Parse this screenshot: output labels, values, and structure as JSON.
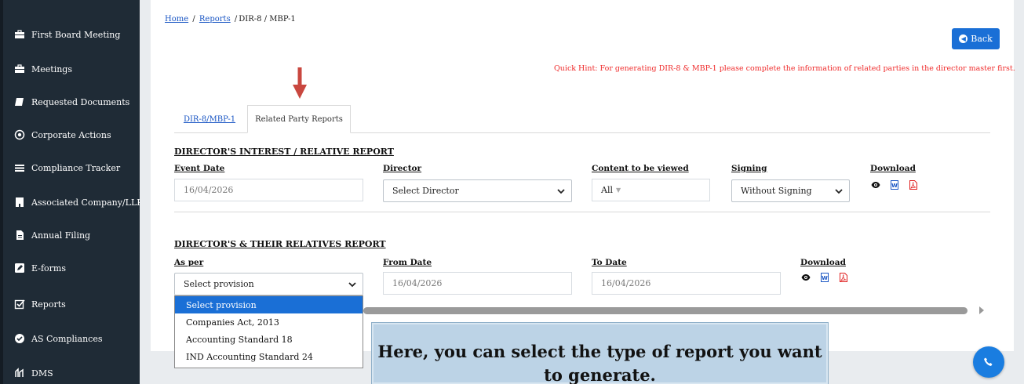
{
  "sidebar": {
    "items": [
      {
        "label": "First Board Meeting",
        "icon": "briefcase-icon"
      },
      {
        "label": "Meetings",
        "icon": "briefcase-icon"
      },
      {
        "label": "Requested Documents",
        "icon": "book-icon"
      },
      {
        "label": "Corporate Actions",
        "icon": "target-icon"
      },
      {
        "label": "Compliance Tracker",
        "icon": "list-icon"
      },
      {
        "label": "Associated Company/LLP",
        "icon": "building-icon"
      },
      {
        "label": "Annual Filing",
        "icon": "file-icon"
      },
      {
        "label": "E-forms",
        "icon": "edit-icon"
      },
      {
        "label": "Reports",
        "icon": "checkbox-icon"
      },
      {
        "label": "AS Compliances",
        "icon": "check-circle-icon"
      },
      {
        "label": "DMS",
        "icon": "dms-icon"
      }
    ]
  },
  "breadcrumb": {
    "home": "Home",
    "sep1": "/",
    "reports": "Reports",
    "sep2": "/",
    "current": "DIR-8 / MBP-1"
  },
  "header": {
    "back_label": "Back",
    "hint": "Quick Hint: For generating DIR-8 & MBP-1 please complete the information of related parties in the director master first."
  },
  "tabs": [
    {
      "label": "DIR-8/MBP-1",
      "active": false
    },
    {
      "label": "Related Party Reports",
      "active": true
    }
  ],
  "section1": {
    "title": "DIRECTOR'S INTEREST / RELATIVE REPORT",
    "event_date_label": "Event Date",
    "event_date_value": "16/04/2026",
    "director_label": "Director",
    "director_value": "Select Director",
    "content_label": "Content to be viewed",
    "content_value": "All",
    "signing_label": "Signing",
    "signing_value": "Without Signing",
    "download_label": "Download"
  },
  "section2": {
    "title": "DIRECTOR'S & THEIR RELATIVES REPORT",
    "as_per_label": "As per",
    "as_per_value": "Select provision",
    "from_label": "From Date",
    "from_value": "16/04/2026",
    "to_label": "To Date",
    "to_value": "16/04/2026",
    "download_label": "Download"
  },
  "dropdown": {
    "options": [
      "Select provision",
      "Companies Act, 2013",
      "Accounting Standard 18",
      "IND Accounting Standard 24"
    ],
    "selected_index": 0
  },
  "tooltip": {
    "text": "Here, you can select the type of report you want to generate."
  },
  "colors": {
    "sidebar_bg": "#1f2b36",
    "accent": "#1a6fd6",
    "hint": "#ef2b2b",
    "arrow": "#c9473f",
    "tooltip_bg": "#bcd3e6"
  }
}
